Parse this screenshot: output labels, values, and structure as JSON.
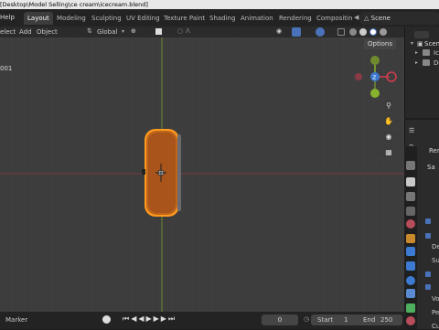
{
  "titlebar": {
    "path": "[Desktop\\Model Selling\\ce cream\\icecream.blend]"
  },
  "menu": {
    "help": "Help",
    "select": "elect",
    "add": "Add",
    "object": "Object"
  },
  "workspaces": [
    "Layout",
    "Modeling",
    "Sculpting",
    "UV Editing",
    "Texture Paint",
    "Shading",
    "Animation",
    "Rendering",
    "Compositin"
  ],
  "scene": {
    "label": "Scene"
  },
  "header": {
    "transform": "Global",
    "options": "Options"
  },
  "viewport": {
    "object_label": "001"
  },
  "outliner": {
    "scene": "Scene",
    "item1": "Ic",
    "item2": "De"
  },
  "properties": {
    "rend": "Rend",
    "sam": "Sa",
    "dep": "Dep",
    "sub": "Sub",
    "per": "Per",
    "vol": "Vol",
    "cur": "Cur"
  },
  "timeline": {
    "marker": "Marker",
    "frame": "0",
    "start_label": "Start",
    "start": "1",
    "end_label": "End",
    "end": "250"
  },
  "colors": {
    "x_axis": "#d33c4e",
    "y_axis": "#86b22d",
    "z_axis": "#3c7bd1",
    "selection": "#ff9a1f"
  }
}
